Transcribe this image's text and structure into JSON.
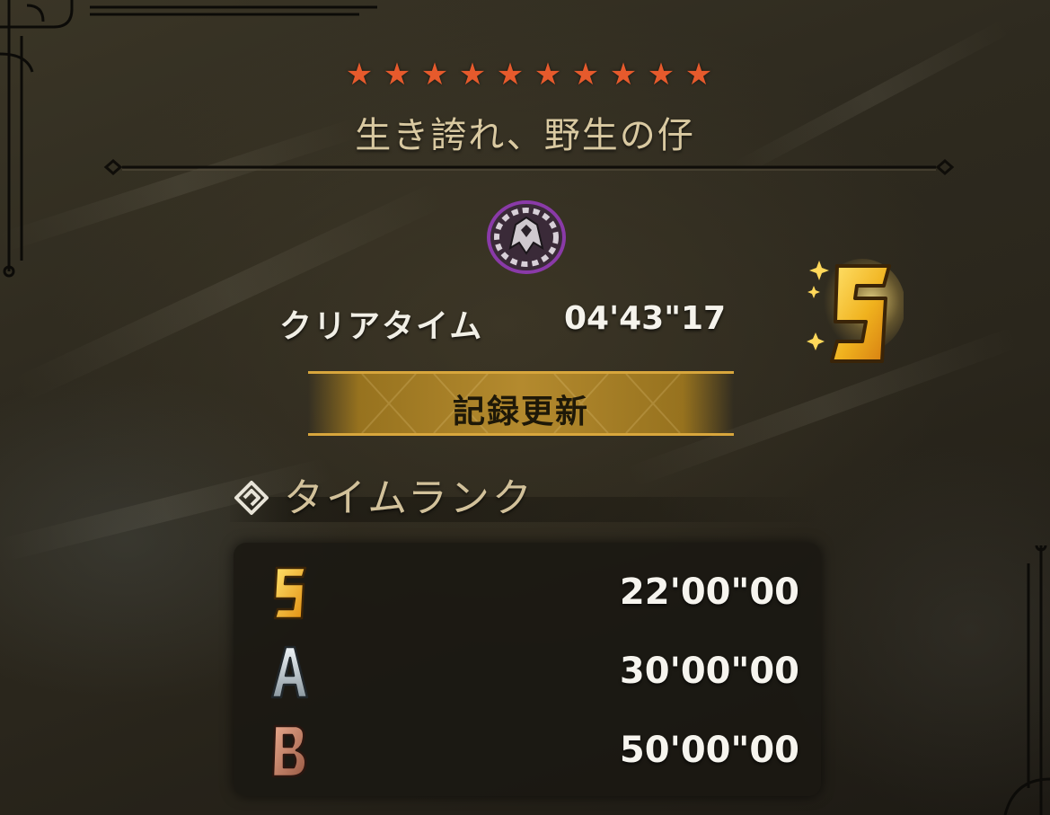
{
  "quest": {
    "difficulty_stars": 10,
    "star_icon": "star-icon",
    "title": "生き誇れ、野生の仔",
    "monster_icon": "monster-emblem-icon"
  },
  "result": {
    "clear_time_label": "クリアタイム",
    "clear_time_value": "04'43\"17",
    "achieved_rank": "S",
    "record_label": "記録更新"
  },
  "time_rank": {
    "section_title": "タイムランク",
    "section_icon": "rank-section-icon",
    "rows": [
      {
        "rank": "S",
        "time": "22'00\"00",
        "color": "#f0b21e"
      },
      {
        "rank": "A",
        "time": "30'00\"00",
        "color": "#c9d2d8"
      },
      {
        "rank": "B",
        "time": "50'00\"00",
        "color": "#c88368"
      }
    ]
  },
  "colors": {
    "star": "#e65a2c",
    "title": "#d9c9a1",
    "banner_gold": "#b48a2e",
    "rank_s_gold": "#f0b21e"
  }
}
